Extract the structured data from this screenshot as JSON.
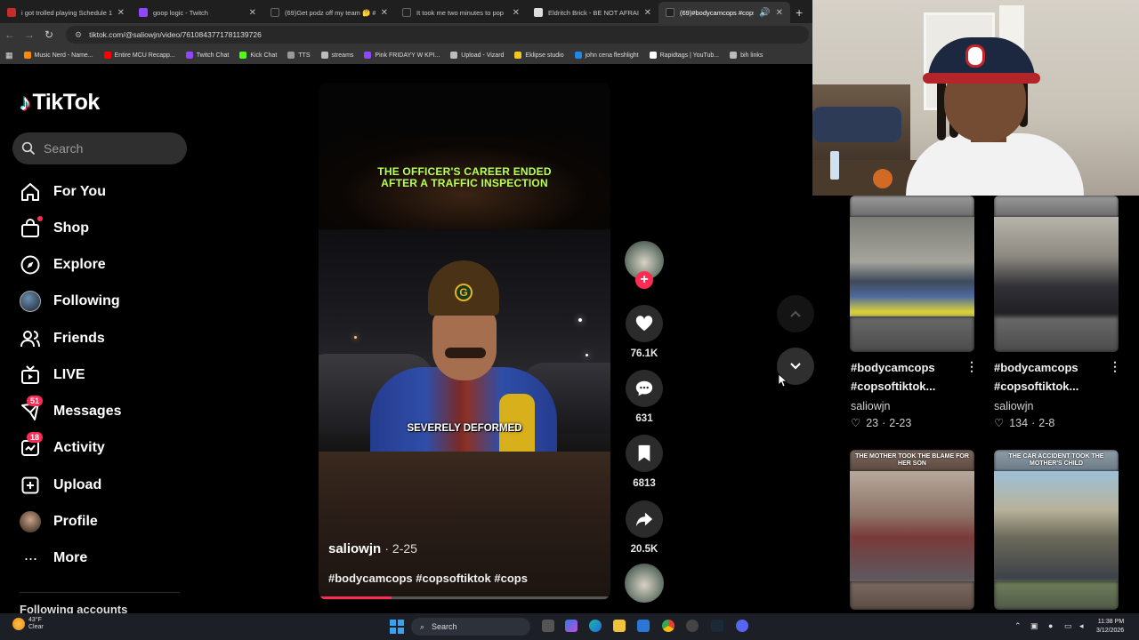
{
  "browser": {
    "tabs": [
      {
        "title": "i got trolled playing Schedule 1",
        "color": "#c92a2a"
      },
      {
        "title": "goop logic - Twitch",
        "color": "#9146ff"
      },
      {
        "title": "(69)Get podz off my team 🤔 #r",
        "color": "#222222"
      },
      {
        "title": "It took me two minutes to pop",
        "color": "#222222"
      },
      {
        "title": "Eldritch Brick - BE NOT AFRAID",
        "color": "#dddddd"
      },
      {
        "title": "(69)#bodycamcops #copso",
        "color": "#222222"
      }
    ],
    "url": "tiktok.com/@saliowjn/video/7610843771781139726",
    "bookmarks": [
      {
        "label": "Music Nerd - Name...",
        "color": "#ff8a00"
      },
      {
        "label": "Entire MCU Recapp...",
        "color": "#ff0000"
      },
      {
        "label": "Twitch Chat",
        "color": "#9146ff"
      },
      {
        "label": "Kick Chat",
        "color": "#53fc18"
      },
      {
        "label": "TTS",
        "color": "#999999"
      },
      {
        "label": "streams",
        "color": "#bbbbbb"
      },
      {
        "label": "Pink FRIDAYY W KPI...",
        "color": "#9146ff"
      },
      {
        "label": "Upload - Vizard",
        "color": "#bbbbbb"
      },
      {
        "label": "Eklipse studio",
        "color": "#f3c623"
      },
      {
        "label": "john cena fleshlight",
        "color": "#1e88e5"
      },
      {
        "label": "Rapidtags | YouTub...",
        "color": "#ffffff"
      },
      {
        "label": "bih links",
        "color": "#bbbbbb"
      }
    ]
  },
  "sidebar": {
    "logo": "TikTok",
    "search_placeholder": "Search",
    "items": [
      {
        "label": "For You",
        "icon": "home-icon"
      },
      {
        "label": "Shop",
        "icon": "shop-icon"
      },
      {
        "label": "Explore",
        "icon": "compass-icon"
      },
      {
        "label": "Following",
        "icon": "following-avatar"
      },
      {
        "label": "Friends",
        "icon": "friends-icon"
      },
      {
        "label": "LIVE",
        "icon": "live-icon"
      },
      {
        "label": "Messages",
        "icon": "messages-icon",
        "badge": "51"
      },
      {
        "label": "Activity",
        "icon": "activity-icon",
        "badge": "18"
      },
      {
        "label": "Upload",
        "icon": "upload-icon"
      },
      {
        "label": "Profile",
        "icon": "profile-avatar"
      },
      {
        "label": "More",
        "icon": "more-icon"
      }
    ],
    "following_accounts": "Following accounts"
  },
  "video": {
    "caption_top_1": "THE OFFICER'S CAREER ENDED",
    "caption_top_2": "AFTER A TRAFFIC INSPECTION",
    "caption_mid": "SEVERELY DEFORMED",
    "author": "saliowjn",
    "date": "· 2-25",
    "hashtags": "#bodycamcops #copsoftiktok #cops",
    "progress": 0.25
  },
  "actions": {
    "likes": "76.1K",
    "comments": "631",
    "saves": "6813",
    "shares": "20.5K"
  },
  "recommendations": [
    {
      "title1": "#bodycamcops",
      "title2": "#copsoftiktok...",
      "author": "saliowjn",
      "likes": "23",
      "date": "2-23",
      "thumb_caption": ""
    },
    {
      "title1": "#bodycamcops",
      "title2": "#copsoftiktok...",
      "author": "saliowjn",
      "likes": "134",
      "date": "2-8",
      "thumb_caption": ""
    },
    {
      "title1": "",
      "title2": "",
      "author": "",
      "likes": "",
      "date": "",
      "thumb_caption": "THE MOTHER TOOK THE BLAME FOR HER SON"
    },
    {
      "title1": "",
      "title2": "",
      "author": "",
      "likes": "",
      "date": "",
      "thumb_caption": "THE CAR ACCIDENT TOOK THE MOTHER'S CHILD"
    }
  ],
  "taskbar": {
    "weather_temp": "43°F",
    "weather_desc": "Clear",
    "search_label": "Search",
    "time": "11:38 PM",
    "date": "3/12/2026"
  }
}
